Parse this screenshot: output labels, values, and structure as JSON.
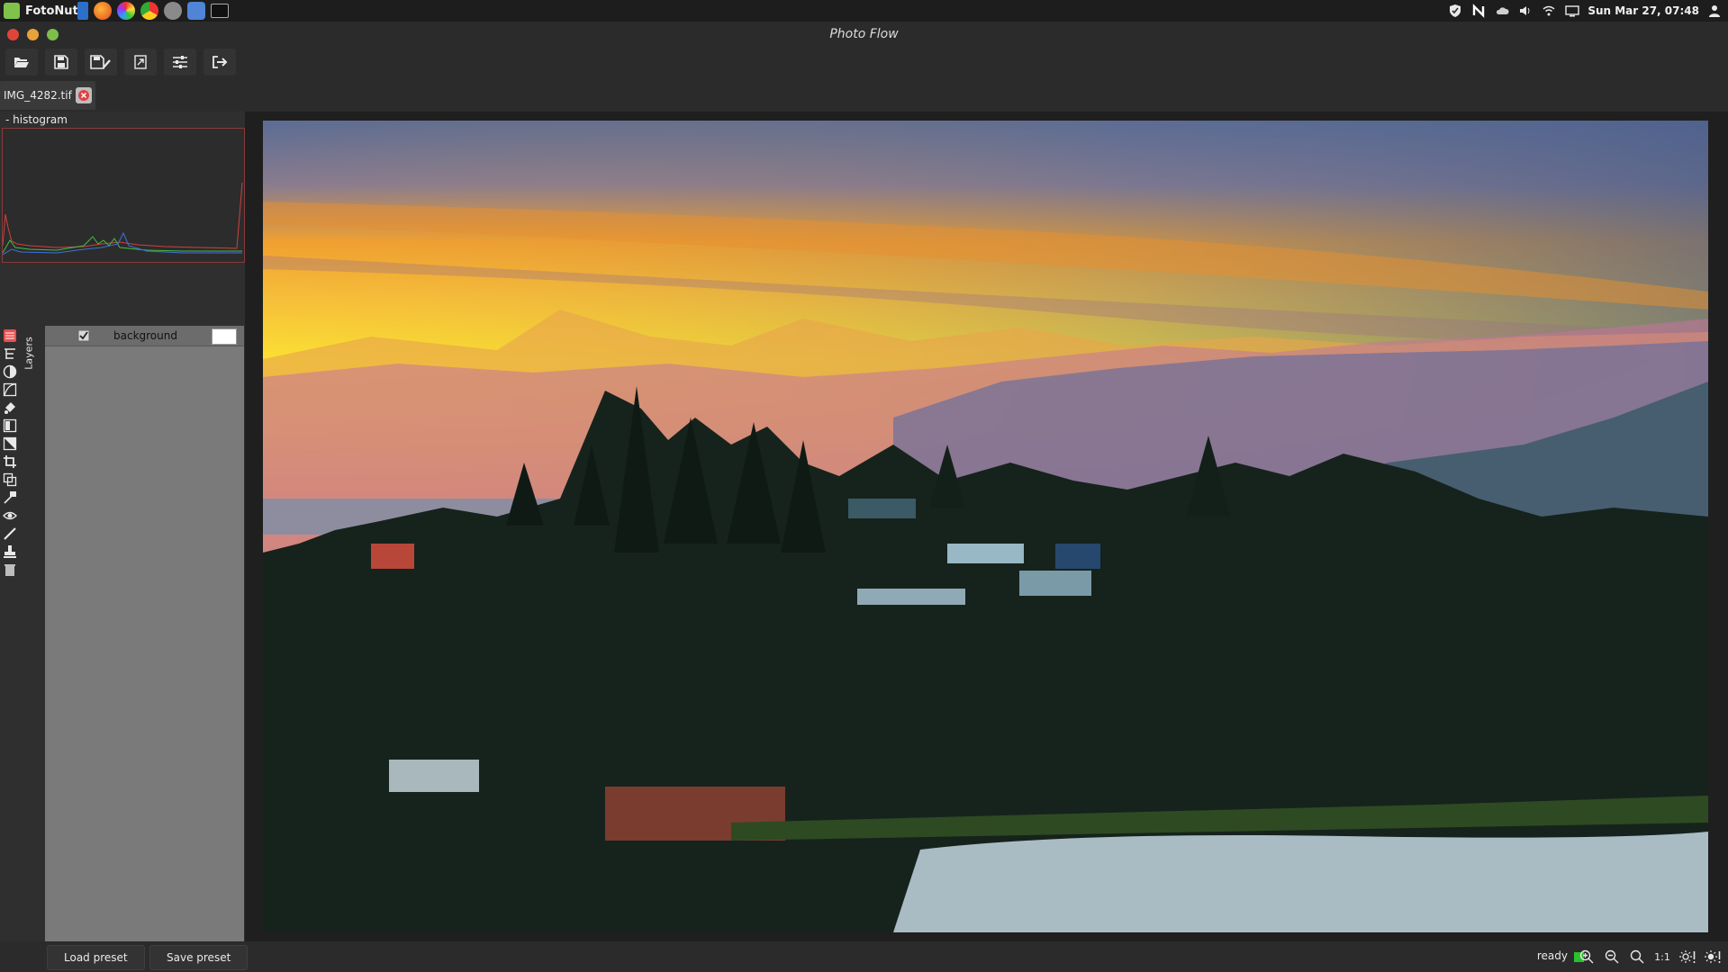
{
  "system_bar": {
    "app_name": "FotoNut",
    "clock": "Sun Mar 27, 07:48"
  },
  "window": {
    "title": "Photo Flow"
  },
  "tab": {
    "filename": "IMG_4282.tif"
  },
  "histogram": {
    "label": "- histogram"
  },
  "layers": {
    "tab_label": "Layers",
    "items": [
      {
        "name": "background",
        "visible": true
      }
    ]
  },
  "bottom": {
    "load_preset": "Load preset",
    "save_preset": "Save preset",
    "status": "ready",
    "zoom_actual": "1:1"
  },
  "colors": {
    "status_ok": "#29c12d",
    "histogram_border": "#8a3a3a"
  }
}
